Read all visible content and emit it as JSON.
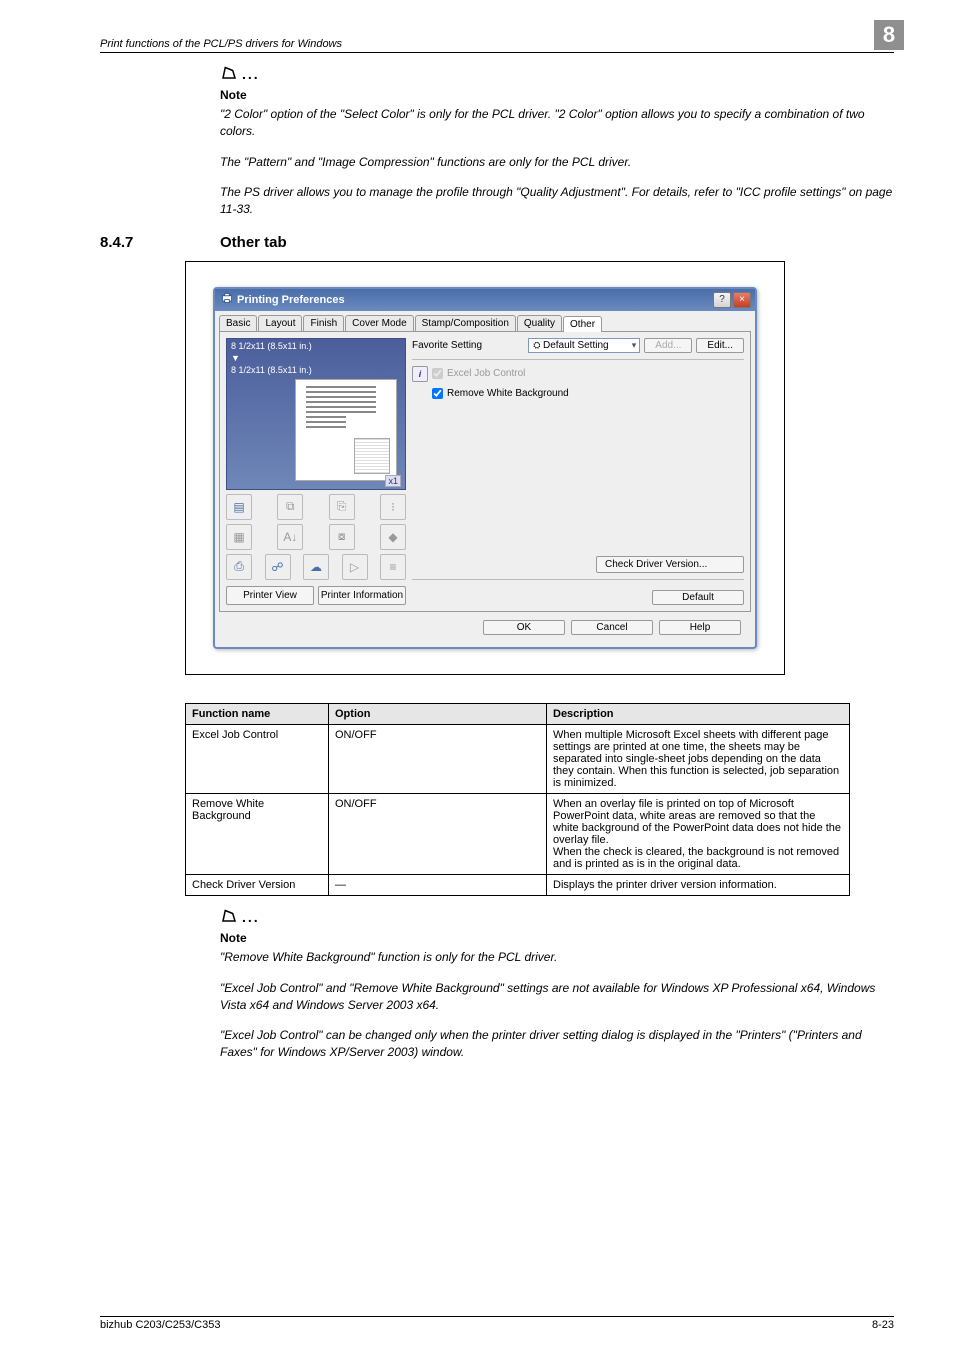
{
  "header": {
    "title": "Print functions of the PCL/PS drivers for Windows",
    "chapter_number": "8"
  },
  "note_top": {
    "label": "Note",
    "paragraphs": [
      "\"2 Color\" option of the \"Select Color\" is only for the PCL driver. \"2 Color\" option allows you to specify a combination of two colors.",
      "The \"Pattern\" and \"Image Compression\" functions are only for the PCL driver.",
      "The PS driver allows you to manage the profile through \"Quality Adjustment\". For details, refer to \"ICC profile settings\" on page 11-33."
    ]
  },
  "section": {
    "number": "8.4.7",
    "title": "Other tab"
  },
  "dialog": {
    "title": "Printing Preferences",
    "help_btn": "?",
    "close_btn": "×",
    "tabs": [
      "Basic",
      "Layout",
      "Finish",
      "Cover Mode",
      "Stamp/Composition",
      "Quality",
      "Other"
    ],
    "active_tab": "Other",
    "preview": {
      "line1": "8 1/2x11 (8.5x11 in.)",
      "line2": "8 1/2x11 (8.5x11 in.)",
      "zoom": "x1"
    },
    "icons": [
      {
        "name": "booklet-icon",
        "glyph": "▤"
      },
      {
        "name": "combine-icon",
        "glyph": "⧉"
      },
      {
        "name": "staple-icon",
        "glyph": "⎘"
      },
      {
        "name": "punch-icon",
        "glyph": "⁝"
      },
      {
        "name": "overlay-icon",
        "glyph": "▦"
      },
      {
        "name": "watermark-icon",
        "glyph": "A↓"
      },
      {
        "name": "stamp-icon",
        "glyph": "⧇"
      },
      {
        "name": "color-icon",
        "glyph": "◆"
      },
      {
        "name": "copy-icon",
        "glyph": "⎙"
      },
      {
        "name": "secure-icon",
        "glyph": "☍"
      },
      {
        "name": "folder-icon",
        "glyph": "☁"
      },
      {
        "name": "stamp2-icon",
        "glyph": "▷"
      },
      {
        "name": "lines-icon",
        "glyph": "≡"
      }
    ],
    "leftbtns": {
      "printer_view": "Printer View",
      "printer_info": "Printer Information"
    },
    "favorite": {
      "label": "Favorite Setting",
      "selected": "Default Setting",
      "add": "Add...",
      "edit": "Edit..."
    },
    "info_icon": "i",
    "excel_job_control": "Excel Job Control",
    "remove_white": "Remove White Background",
    "check_driver": "Check Driver Version...",
    "default_btn": "Default",
    "ok": "OK",
    "cancel": "Cancel",
    "help": "Help"
  },
  "table": {
    "headers": {
      "func": "Function name",
      "option": "Option",
      "desc": "Description"
    },
    "rows": [
      {
        "func": "Excel Job Control",
        "option": "ON/OFF",
        "desc": "When multiple Microsoft Excel sheets with different page settings are printed at one time, the sheets may be separated into single-sheet jobs depending on the data they contain. When this function is selected, job separation is minimized."
      },
      {
        "func": "Remove White Background",
        "option": "ON/OFF",
        "desc": "When an overlay file is printed on top of Microsoft PowerPoint data, white areas are removed so that the white background of the PowerPoint data does not hide the overlay file.\nWhen the check is cleared, the background is not removed and is printed as is in the original data."
      },
      {
        "func": "Check Driver Version",
        "option": "—",
        "desc": "Displays the printer driver version information."
      }
    ]
  },
  "note_bottom": {
    "label": "Note",
    "paragraphs": [
      "\"Remove White Background\" function is only for the PCL driver.",
      "\"Excel Job Control\" and \"Remove White Background\" settings are not available for Windows XP Professional x64, Windows Vista x64 and Windows Server 2003 x64.",
      "\"Excel Job Control\" can be changed only when the printer driver setting dialog is displayed in the \"Printers\" (\"Printers and Faxes\" for Windows XP/Server 2003) window."
    ]
  },
  "footer": {
    "left": "bizhub C203/C253/C353",
    "right": "8-23"
  }
}
